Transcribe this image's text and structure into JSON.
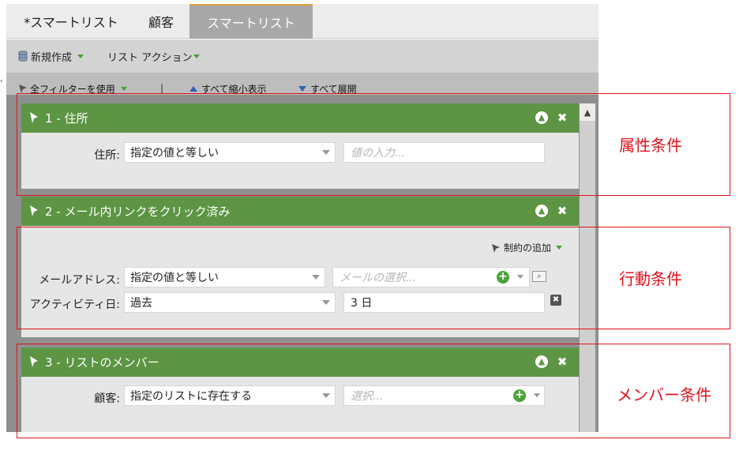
{
  "tabs": [
    {
      "label": "*スマートリスト"
    },
    {
      "label": "顧客"
    },
    {
      "label": "スマートリスト"
    }
  ],
  "toolbar": {
    "new_label": "新規作成",
    "list_actions_label": "リスト アクション"
  },
  "filter_toolbar": {
    "use_all_filters": "全フィルターを使用",
    "separator": "|",
    "collapse_all": "すべて縮小表示",
    "expand_all": "すべて展開"
  },
  "filters": [
    {
      "title": "1 - 住所",
      "rows": [
        {
          "label": "住所:",
          "operator": "指定の値と等しい",
          "value_placeholder": "値の入力..."
        }
      ]
    },
    {
      "title": "2 - メール内リンクをクリック済み",
      "add_constraint": "制約の追加",
      "rows": [
        {
          "label": "メールアドレス:",
          "operator": "指定の値と等しい",
          "value_placeholder": "メールの選択..."
        },
        {
          "label": "アクティビティ日:",
          "operator": "過去",
          "value": "3 日"
        }
      ]
    },
    {
      "title": "3 - リストのメンバー",
      "rows": [
        {
          "label": "顧客:",
          "operator": "指定のリストに存在する",
          "value_placeholder": "選択..."
        }
      ]
    }
  ],
  "annotations": {
    "attribute": "属性条件",
    "behavior": "行動条件",
    "member": "メンバー条件"
  },
  "colors": {
    "header_green": "#5d9544",
    "annotation_red": "#e0131a",
    "tab_accent": "#e8a13a"
  }
}
